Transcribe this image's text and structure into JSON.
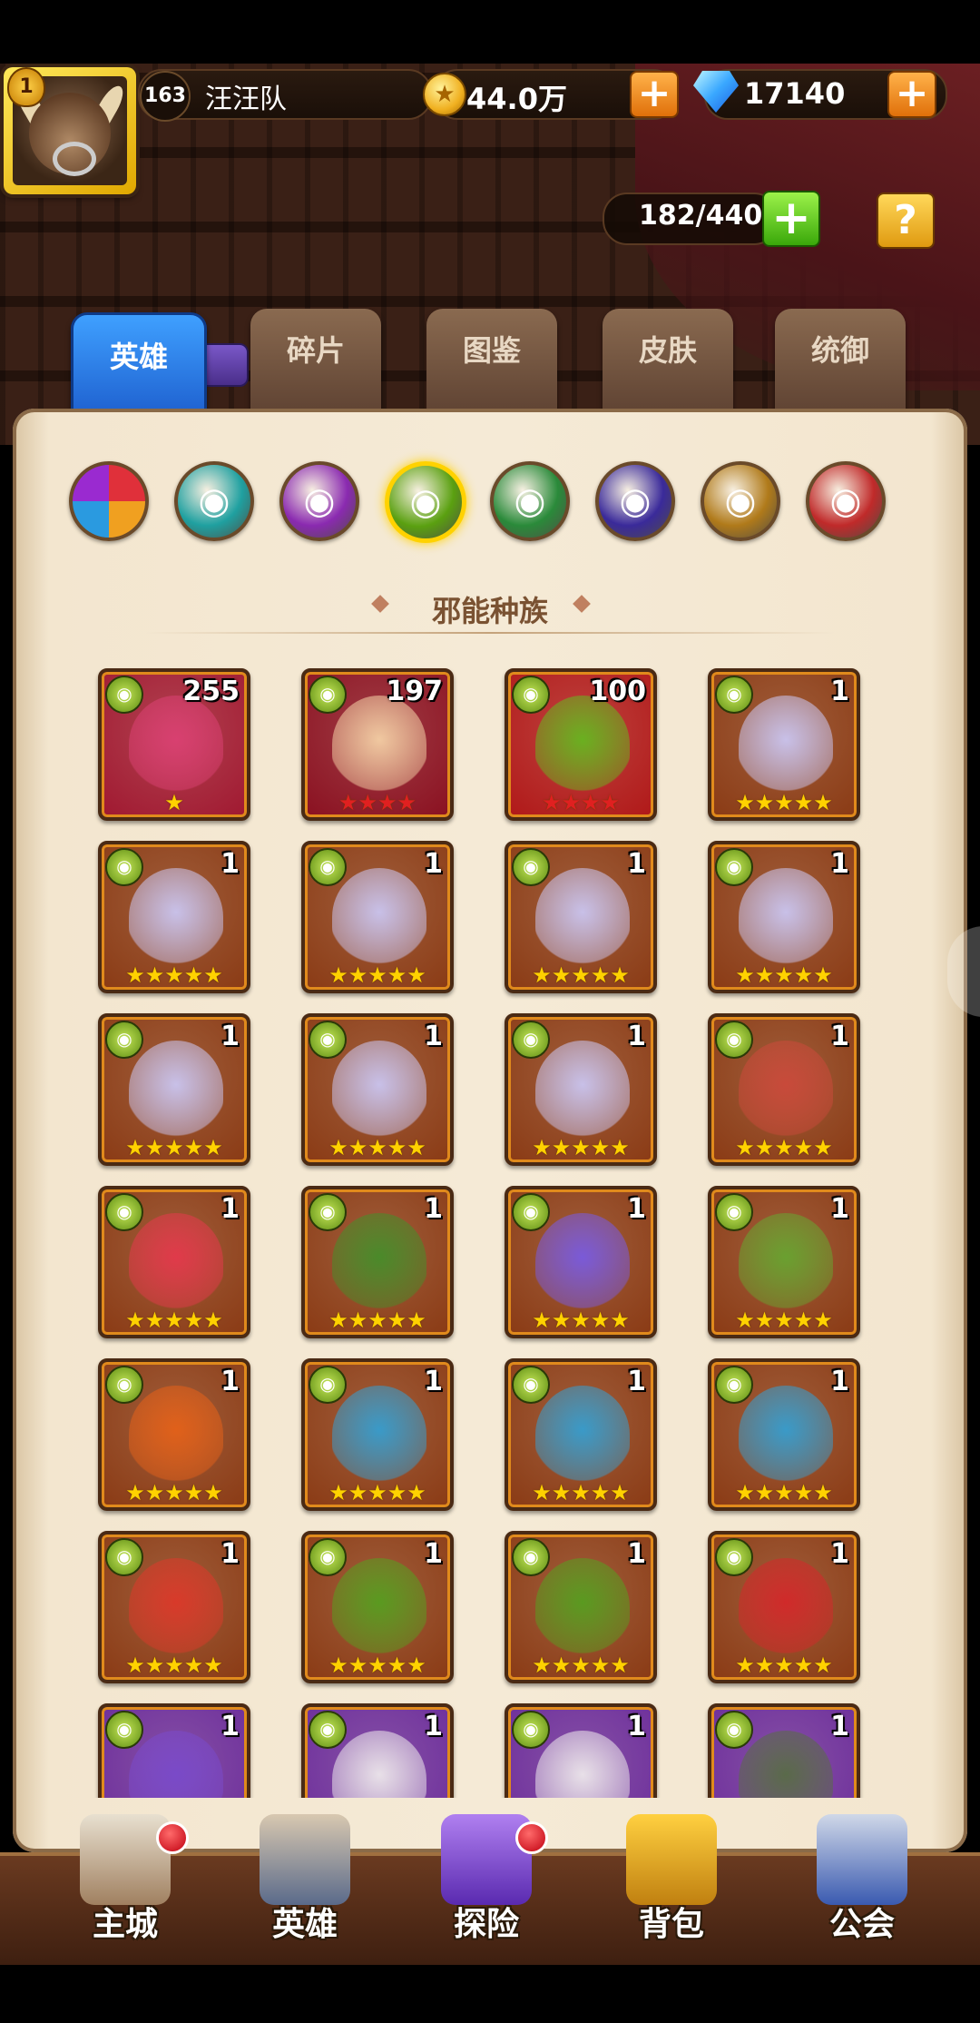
{
  "player": {
    "level": "163",
    "name": "汪汪队",
    "rank_badge": "1"
  },
  "resources": {
    "gold": "44.0万",
    "diamonds": "17140"
  },
  "capacity": "182/440",
  "help_label": "?",
  "tabs": [
    "英雄",
    "碎片",
    "图鉴",
    "皮肤",
    "统御"
  ],
  "active_tab": "英雄",
  "factions": [
    {
      "name": "all",
      "color": "#e04a3a"
    },
    {
      "name": "faction-1",
      "color": "#1fa0a0"
    },
    {
      "name": "faction-2",
      "color": "#8a2ab0"
    },
    {
      "name": "faction-3",
      "color": "#5aa010",
      "selected": true
    },
    {
      "name": "faction-4",
      "color": "#2a8a3a"
    },
    {
      "name": "faction-5",
      "color": "#3a2a9a"
    },
    {
      "name": "faction-6",
      "color": "#b07a1a"
    },
    {
      "name": "faction-7",
      "color": "#c02a2a"
    }
  ],
  "section_title": "邪能种族",
  "heroes": [
    {
      "count": "255",
      "stars": "★",
      "star_color": "gold",
      "bg": "#a01830",
      "art": "#d84070"
    },
    {
      "count": "197",
      "stars": "★★★★",
      "star_color": "red",
      "bg": "#8a1020",
      "art": "#f0c8a0"
    },
    {
      "count": "100",
      "stars": "★★★★",
      "star_color": "red",
      "bg": "#b01818",
      "art": "#6ab020"
    },
    {
      "count": "1",
      "stars": "★★★★★",
      "star_color": "gold",
      "bg": "#8a3a14",
      "art": "#c8c0e8"
    },
    {
      "count": "1",
      "stars": "★★★★★",
      "star_color": "gold",
      "bg": "#8a3a14",
      "art": "#c8c0e8"
    },
    {
      "count": "1",
      "stars": "★★★★★",
      "star_color": "gold",
      "bg": "#8a3a14",
      "art": "#c8c0e8"
    },
    {
      "count": "1",
      "stars": "★★★★★",
      "star_color": "gold",
      "bg": "#8a3a14",
      "art": "#c8c0e8"
    },
    {
      "count": "1",
      "stars": "★★★★★",
      "star_color": "gold",
      "bg": "#8a3a14",
      "art": "#c8c0e8"
    },
    {
      "count": "1",
      "stars": "★★★★★",
      "star_color": "gold",
      "bg": "#8a3a14",
      "art": "#c8c0e8"
    },
    {
      "count": "1",
      "stars": "★★★★★",
      "star_color": "gold",
      "bg": "#8a3a14",
      "art": "#c8c0e8"
    },
    {
      "count": "1",
      "stars": "★★★★★",
      "star_color": "gold",
      "bg": "#8a3a14",
      "art": "#c8c0e8"
    },
    {
      "count": "1",
      "stars": "★★★★★",
      "star_color": "gold",
      "bg": "#8a3a14",
      "art": "#c84a3a"
    },
    {
      "count": "1",
      "stars": "★★★★★",
      "star_color": "gold",
      "bg": "#8a3a14",
      "art": "#e03a4a"
    },
    {
      "count": "1",
      "stars": "★★★★★",
      "star_color": "gold",
      "bg": "#8a3a14",
      "art": "#4a8a2a"
    },
    {
      "count": "1",
      "stars": "★★★★★",
      "star_color": "gold",
      "bg": "#8a3a14",
      "art": "#7a5ad8"
    },
    {
      "count": "1",
      "stars": "★★★★★",
      "star_color": "gold",
      "bg": "#8a3a14",
      "art": "#6aa030"
    },
    {
      "count": "1",
      "stars": "★★★★★",
      "star_color": "gold",
      "bg": "#8a3a14",
      "art": "#e0601a"
    },
    {
      "count": "1",
      "stars": "★★★★★",
      "star_color": "gold",
      "bg": "#8a3a14",
      "art": "#3a9ac8"
    },
    {
      "count": "1",
      "stars": "★★★★★",
      "star_color": "gold",
      "bg": "#8a3a14",
      "art": "#3a9ac8"
    },
    {
      "count": "1",
      "stars": "★★★★★",
      "star_color": "gold",
      "bg": "#8a3a14",
      "art": "#3a9ac8"
    },
    {
      "count": "1",
      "stars": "★★★★★",
      "star_color": "gold",
      "bg": "#8a3a14",
      "art": "#d83a2a"
    },
    {
      "count": "1",
      "stars": "★★★★★",
      "star_color": "gold",
      "bg": "#8a3a14",
      "art": "#5a9a20"
    },
    {
      "count": "1",
      "stars": "★★★★★",
      "star_color": "gold",
      "bg": "#8a3a14",
      "art": "#5a9a20"
    },
    {
      "count": "1",
      "stars": "★★★★★",
      "star_color": "gold",
      "bg": "#8a3a14",
      "art": "#d02a2a"
    },
    {
      "count": "1",
      "stars": "",
      "star_color": "gold",
      "bg": "#6a2a9a",
      "art": "#7a4ac8"
    },
    {
      "count": "1",
      "stars": "",
      "star_color": "gold",
      "bg": "#6a2a9a",
      "art": "#e8e0e8"
    },
    {
      "count": "1",
      "stars": "",
      "star_color": "gold",
      "bg": "#6a2a9a",
      "art": "#e8e0e8"
    },
    {
      "count": "1",
      "stars": "",
      "star_color": "gold",
      "bg": "#6a2a9a",
      "art": "#5a6a4a"
    }
  ],
  "nav": [
    "主城",
    "英雄",
    "探险",
    "背包",
    "公会"
  ]
}
